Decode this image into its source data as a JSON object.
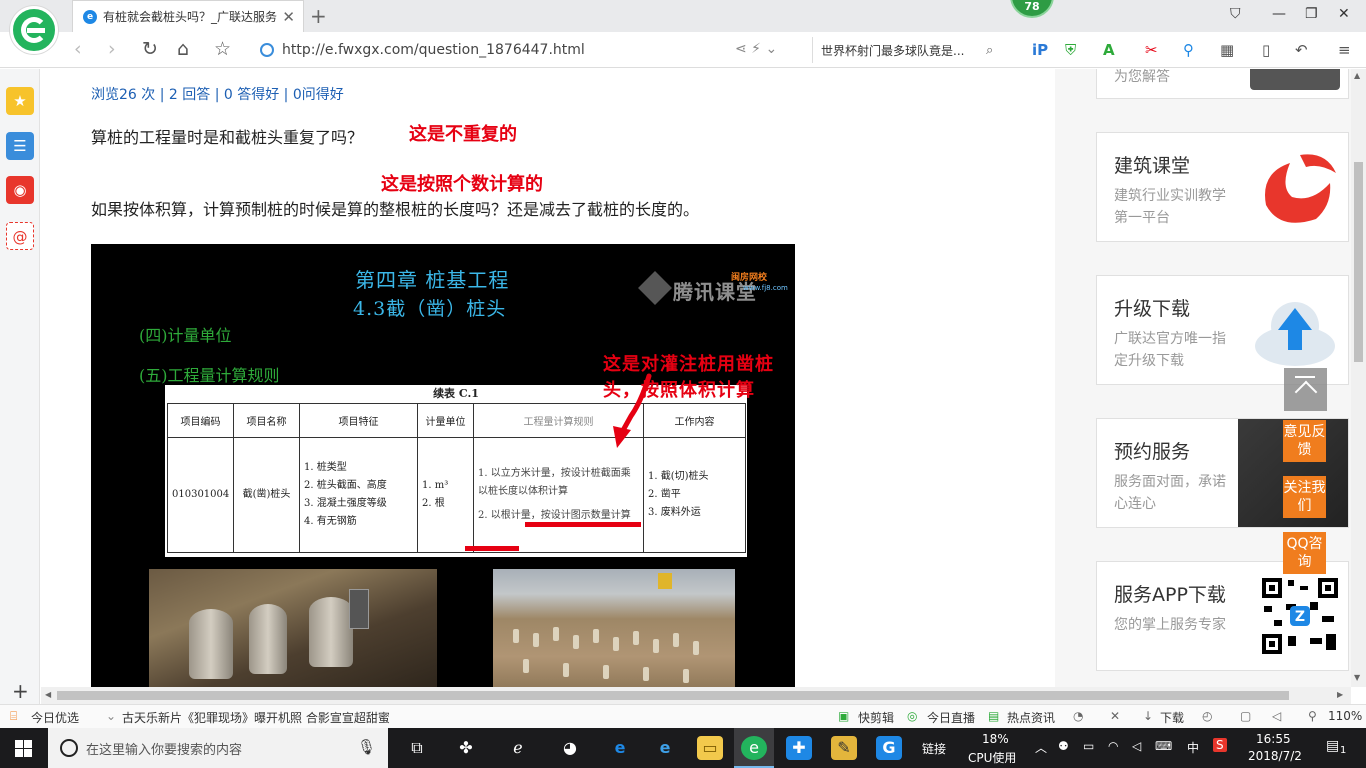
{
  "browser": {
    "tab_title": "有桩就会截桩头吗？_广联达服务",
    "tab_favicon": "e",
    "badge_count": "78",
    "url": "http://e.fwxgx.com/question_1876447.html",
    "search_text": "世界杯射门最多球队竟是..."
  },
  "page": {
    "stats": "浏览26 次 | 2 回答 | 0 答得好 | 0问得好",
    "question1": "算桩的工程量时是和截桩头重复了吗？",
    "answer1": "这是不重复的",
    "answer2": "这是按照个数计算的",
    "question2": "如果按体积算，计算预制桩的时候是算的整根桩的长度吗？还是减去了截桩的长度的。"
  },
  "slide": {
    "title1": "第四章  桩基工程",
    "title2": "4.3截（凿）桩头",
    "line1": "(四)计量单位",
    "line2": "(五)工程量计算规则",
    "watermark_text": "腾讯课堂",
    "watermark_small": "闽房网校",
    "watermark_url": "www.fj8.com",
    "annotation": "这是对灌注桩用凿桩头，按照体积计算",
    "table": {
      "caption": "续表 C.1",
      "headers": [
        "项目编码",
        "项目名称",
        "项目特征",
        "计量单位",
        "工程量计算规则",
        "工作内容"
      ],
      "code": "010301004",
      "name": "截(凿)桩头",
      "features": [
        "1. 桩类型",
        "2. 桩头截面、高度",
        "3. 混凝土强度等级",
        "4. 有无钢筋"
      ],
      "units": [
        "1. m³",
        "2. 根"
      ],
      "rules": [
        "1. 以立方米计量，按设计桩截面乘以桩长度以体积计算",
        "2. 以根计量，按设计图示数量计算"
      ],
      "work": [
        "1. 截(切)桩头",
        "2. 凿平",
        "3. 废料外运"
      ]
    }
  },
  "ads": [
    {
      "title": "",
      "desc": "为您解答"
    },
    {
      "title": "建筑课堂",
      "desc": "建筑行业实训教学第一平台"
    },
    {
      "title": "升级下载",
      "desc": "广联达官方唯一指定升级下载"
    },
    {
      "title": "预约服务",
      "desc": "服务面对面，承诺心连心"
    },
    {
      "title": "服务APP下载",
      "desc": "您的掌上服务专家"
    }
  ],
  "side_buttons": {
    "feedback": "意见反馈",
    "follow": "关注我们",
    "qq": "QQ咨询"
  },
  "statusbar": {
    "today": "今日优选",
    "news": "古天乐新片《犯罪现场》曝开机照 合影宣宣超甜蜜",
    "kuaijianji": "快剪辑",
    "live": "今日直播",
    "hot": "热点资讯",
    "download": "下载",
    "zoom": "110%"
  },
  "taskbar": {
    "search_placeholder": "在这里输入你要搜索的内容",
    "link": "链接",
    "cpu_percent": "18%",
    "cpu_label": "CPU使用",
    "lang": "中",
    "time": "16:55",
    "date": "2018/7/2",
    "notif_count": "1"
  },
  "colors": {
    "accent_red": "#e60012",
    "link_blue": "#1d5fb3",
    "slide_title": "#3bb7e8",
    "slide_green": "#2eaa3a",
    "orange": "#f07d1e",
    "browser_green": "#23b45d"
  }
}
